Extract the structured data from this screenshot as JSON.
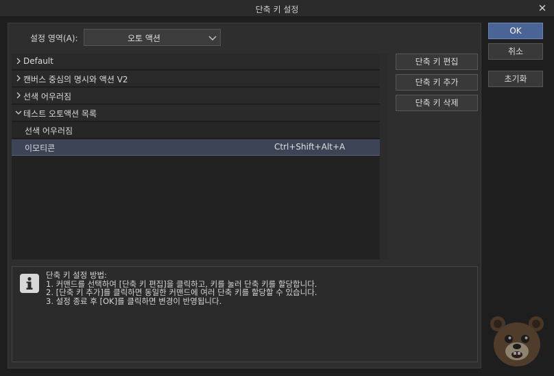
{
  "window": {
    "title": "단축 키 설정",
    "close_glyph": "✕"
  },
  "settings_area": {
    "label": "설정 영역(A):",
    "selected": "오토 액션"
  },
  "tree": {
    "rows": [
      {
        "label": "Default",
        "expanded": false,
        "level": 0
      },
      {
        "label": "캔버스 중심의 명시와 액션 V2",
        "expanded": false,
        "level": 0
      },
      {
        "label": "선색 어우러짐",
        "expanded": false,
        "level": 0
      },
      {
        "label": "테스트 오토액션 목록",
        "expanded": true,
        "level": 0
      },
      {
        "label": "선색 어우러짐",
        "level": 1,
        "shortcut": ""
      },
      {
        "label": "이모티콘",
        "level": 1,
        "shortcut": "Ctrl+Shift+Alt+A",
        "selected": true
      }
    ]
  },
  "side_buttons": {
    "edit": "단축 키 편집",
    "add": "단축 키 추가",
    "delete": "단축 키 삭제"
  },
  "dialog_buttons": {
    "ok": "OK",
    "cancel": "취소",
    "reset": "초기화"
  },
  "info": {
    "icon": "info-icon",
    "lines": [
      "단축 키 설정 방법:",
      "1. 커맨드를 선택하여 [단축 키 편집]을 클릭하고, 키를 눌러 단축 키를 할당합니다.",
      "2. [단축 키 추가]를 클릭하면 동일한 커맨드에 여러 단축 키를 할당할 수 있습니다.",
      "3. 설정 종료 후 [OK]를 클릭하면 변경이 반영됩니다."
    ]
  },
  "colors": {
    "accent": "#4a6496",
    "selected_row": "#3d4455"
  }
}
